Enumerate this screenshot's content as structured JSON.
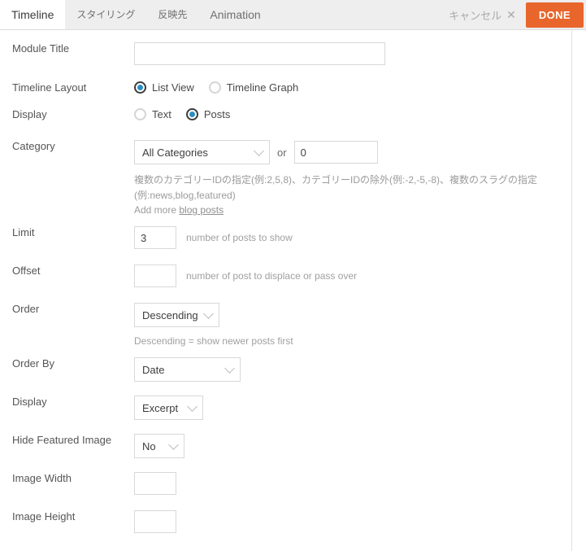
{
  "header": {
    "tabs": [
      {
        "label": "Timeline",
        "active": true
      },
      {
        "label": "スタイリング",
        "active": false
      },
      {
        "label": "反映先",
        "active": false
      },
      {
        "label": "Animation",
        "active": false
      }
    ],
    "cancel_label": "キャンセル",
    "cancel_icon": "close-icon",
    "done_label": "DONE",
    "accent_color": "#e8662c"
  },
  "form": {
    "module_title": {
      "label": "Module Title",
      "value": "",
      "placeholder": ""
    },
    "timeline_layout": {
      "label": "Timeline Layout",
      "options": [
        {
          "label": "List View",
          "selected": true
        },
        {
          "label": "Timeline Graph",
          "selected": false
        }
      ]
    },
    "display_type": {
      "label": "Display",
      "options": [
        {
          "label": "Text",
          "selected": false
        },
        {
          "label": "Posts",
          "selected": true
        }
      ]
    },
    "category": {
      "label": "Category",
      "select_value": "All Categories",
      "or_text": "or",
      "id_value": "0",
      "hint_line1": "複数のカテゴリーIDの指定(例:2,5,8)、カテゴリーIDの除外(例:-2,-5,-8)、複数のスラグの指定",
      "hint_line2": "(例:news,blog,featured)",
      "add_more_prefix": "Add more",
      "add_more_link": "blog posts"
    },
    "limit": {
      "label": "Limit",
      "value": "3",
      "hint": "number of posts to show"
    },
    "offset": {
      "label": "Offset",
      "value": "",
      "hint": "number of post to displace or pass over"
    },
    "order": {
      "label": "Order",
      "value": "Descending",
      "hint": "Descending = show newer posts first"
    },
    "order_by": {
      "label": "Order By",
      "value": "Date"
    },
    "display_format": {
      "label": "Display",
      "value": "Excerpt"
    },
    "hide_featured_image": {
      "label": "Hide Featured Image",
      "value": "No"
    },
    "image_width": {
      "label": "Image Width",
      "value": ""
    },
    "image_height": {
      "label": "Image Height",
      "value": ""
    }
  }
}
